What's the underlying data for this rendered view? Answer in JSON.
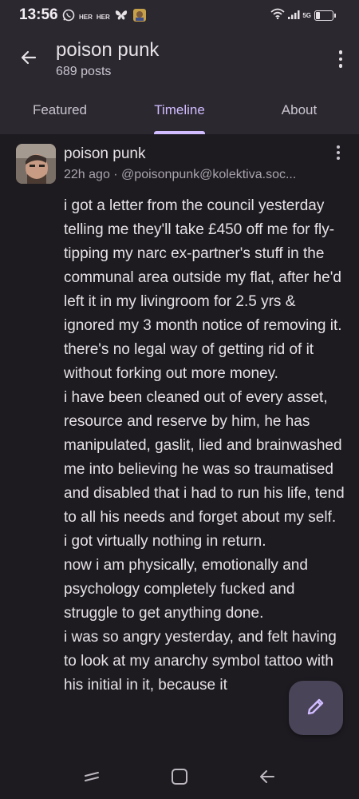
{
  "status_bar": {
    "time": "13:56",
    "notif_labels": [
      "HER",
      "HER"
    ],
    "network": "5G",
    "icons": [
      "whatsapp-icon",
      "butterfly-icon",
      "app-avatar-icon",
      "wifi-icon",
      "signal-icon",
      "battery-icon"
    ]
  },
  "header": {
    "title": "poison punk",
    "subtitle": "689 posts"
  },
  "tabs": [
    {
      "label": "Featured",
      "active": false
    },
    {
      "label": "Timeline",
      "active": true
    },
    {
      "label": "About",
      "active": false
    }
  ],
  "post": {
    "author": "poison punk",
    "meta": "22h ago · @poisonpunk@kolektiva.soc...",
    "body": [
      "i got a letter from the council yesterday telling me they'll take £450 off me for fly-tipping my narc ex-partner's stuff in the communal area outside my flat, after he'd left it in my livingroom for 2.5 yrs & ignored my 3 month notice of removing it.",
      "there's no legal way of getting rid of it without forking out more money.",
      "i have been cleaned out of every asset, resource and reserve by him, he has manipulated, gaslit, lied and brainwashed me into believing he was so traumatised and disabled that i had to run his life, tend to all his needs and forget about my self.",
      "i got virtually nothing in return.",
      "now i am physically, emotionally and psychology completely fucked and struggle to get anything done.",
      "i was so angry yesterday, and felt having to look at my anarchy symbol tattoo with his initial in it, because it"
    ]
  },
  "colors": {
    "accent": "#d0bcff",
    "surface": "#2b2830",
    "background": "#1d1b20",
    "fab": "#4a4458"
  }
}
